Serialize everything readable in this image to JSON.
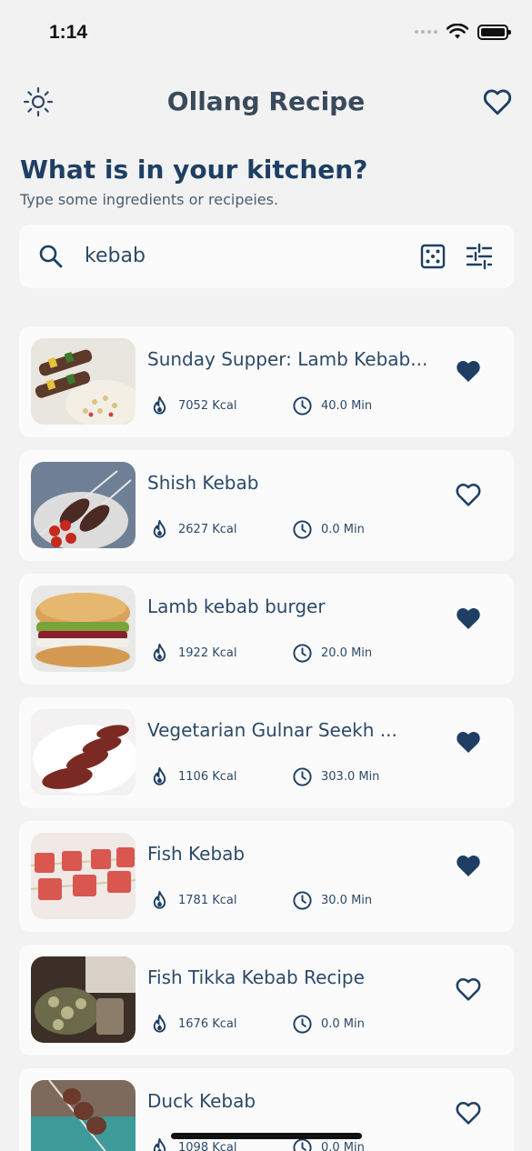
{
  "status_bar": {
    "time": "1:14"
  },
  "header": {
    "title": "Ollang Recipe"
  },
  "intro": {
    "headline": "What is in your kitchen?",
    "subline": "Type some ingredients or recipeies."
  },
  "search": {
    "value": "kebab"
  },
  "colors": {
    "accent": "#1e3f63",
    "background": "#f2f2f2",
    "card": "#fbfbfb"
  },
  "recipes": [
    {
      "name": "Sunday Supper: Lamb Kebab...",
      "kcal": "7052 Kcal",
      "time": "40.0 Min",
      "favorite": true
    },
    {
      "name": "Shish Kebab",
      "kcal": "2627 Kcal",
      "time": "0.0 Min",
      "favorite": false
    },
    {
      "name": "Lamb kebab burger",
      "kcal": "1922 Kcal",
      "time": "20.0 Min",
      "favorite": true
    },
    {
      "name": "Vegetarian Gulnar Seekh ...",
      "kcal": "1106 Kcal",
      "time": "303.0 Min",
      "favorite": true
    },
    {
      "name": "Fish Kebab",
      "kcal": "1781 Kcal",
      "time": "30.0 Min",
      "favorite": true
    },
    {
      "name": "Fish Tikka Kebab Recipe",
      "kcal": "1676 Kcal",
      "time": "0.0 Min",
      "favorite": false
    },
    {
      "name": "Duck Kebab",
      "kcal": "1098 Kcal",
      "time": "0.0 Min",
      "favorite": false
    }
  ]
}
